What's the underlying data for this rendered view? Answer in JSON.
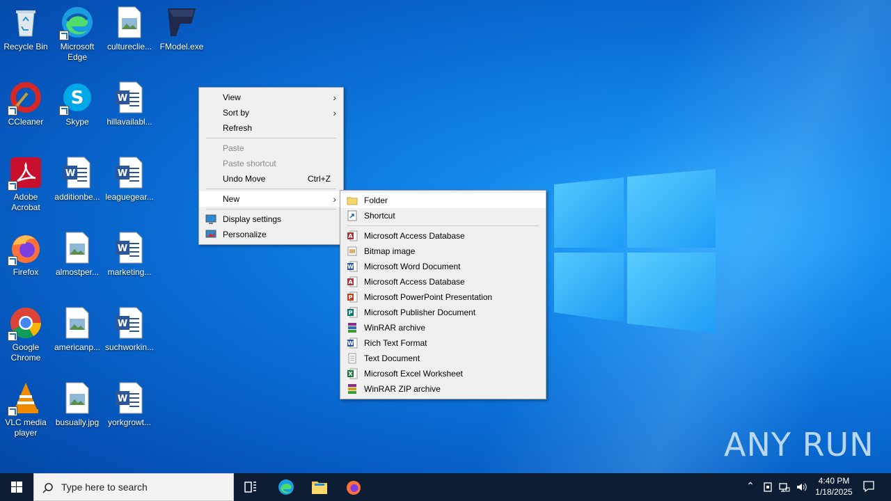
{
  "desktop": {
    "icons": [
      {
        "label": "Recycle Bin"
      },
      {
        "label": "Microsoft Edge"
      },
      {
        "label": "cultureclie..."
      },
      {
        "label": "FModel.exe"
      },
      {
        "label": "CCleaner"
      },
      {
        "label": "Skype"
      },
      {
        "label": "hillavailabl..."
      },
      {
        "label": "Adobe Acrobat"
      },
      {
        "label": "additionbe..."
      },
      {
        "label": "leaguegear..."
      },
      {
        "label": "Firefox"
      },
      {
        "label": "almostper..."
      },
      {
        "label": "marketing..."
      },
      {
        "label": "Google Chrome"
      },
      {
        "label": "americanp..."
      },
      {
        "label": "suchworkin..."
      },
      {
        "label": "VLC media player"
      },
      {
        "label": "busually.jpg"
      },
      {
        "label": "yorkgrowt..."
      }
    ]
  },
  "context_menu": {
    "view": "View",
    "sort_by": "Sort by",
    "refresh": "Refresh",
    "paste": "Paste",
    "paste_shortcut": "Paste shortcut",
    "undo_move": "Undo Move",
    "undo_shortcut": "Ctrl+Z",
    "new": "New",
    "display_settings": "Display settings",
    "personalize": "Personalize"
  },
  "new_submenu": {
    "folder": "Folder",
    "shortcut": "Shortcut",
    "items": [
      {
        "label": "Microsoft Access Database",
        "icon": "access-icon"
      },
      {
        "label": "Bitmap image",
        "icon": "bitmap-icon"
      },
      {
        "label": "Microsoft Word Document",
        "icon": "word-icon"
      },
      {
        "label": "Microsoft Access Database",
        "icon": "access-icon"
      },
      {
        "label": "Microsoft PowerPoint Presentation",
        "icon": "powerpoint-icon"
      },
      {
        "label": "Microsoft Publisher Document",
        "icon": "publisher-icon"
      },
      {
        "label": "WinRAR archive",
        "icon": "winrar-icon"
      },
      {
        "label": "Rich Text Format",
        "icon": "rtf-icon"
      },
      {
        "label": "Text Document",
        "icon": "text-icon"
      },
      {
        "label": "Microsoft Excel Worksheet",
        "icon": "excel-icon"
      },
      {
        "label": "WinRAR ZIP archive",
        "icon": "winrar-zip-icon"
      }
    ]
  },
  "taskbar": {
    "search_placeholder": "Type here to search",
    "time": "4:40 PM",
    "date": "1/18/2025"
  },
  "watermark": "ANY RUN",
  "colors": {
    "taskbar": "#0d1d33",
    "menu_bg": "#f0f0f0",
    "accent": "#0078d7"
  }
}
